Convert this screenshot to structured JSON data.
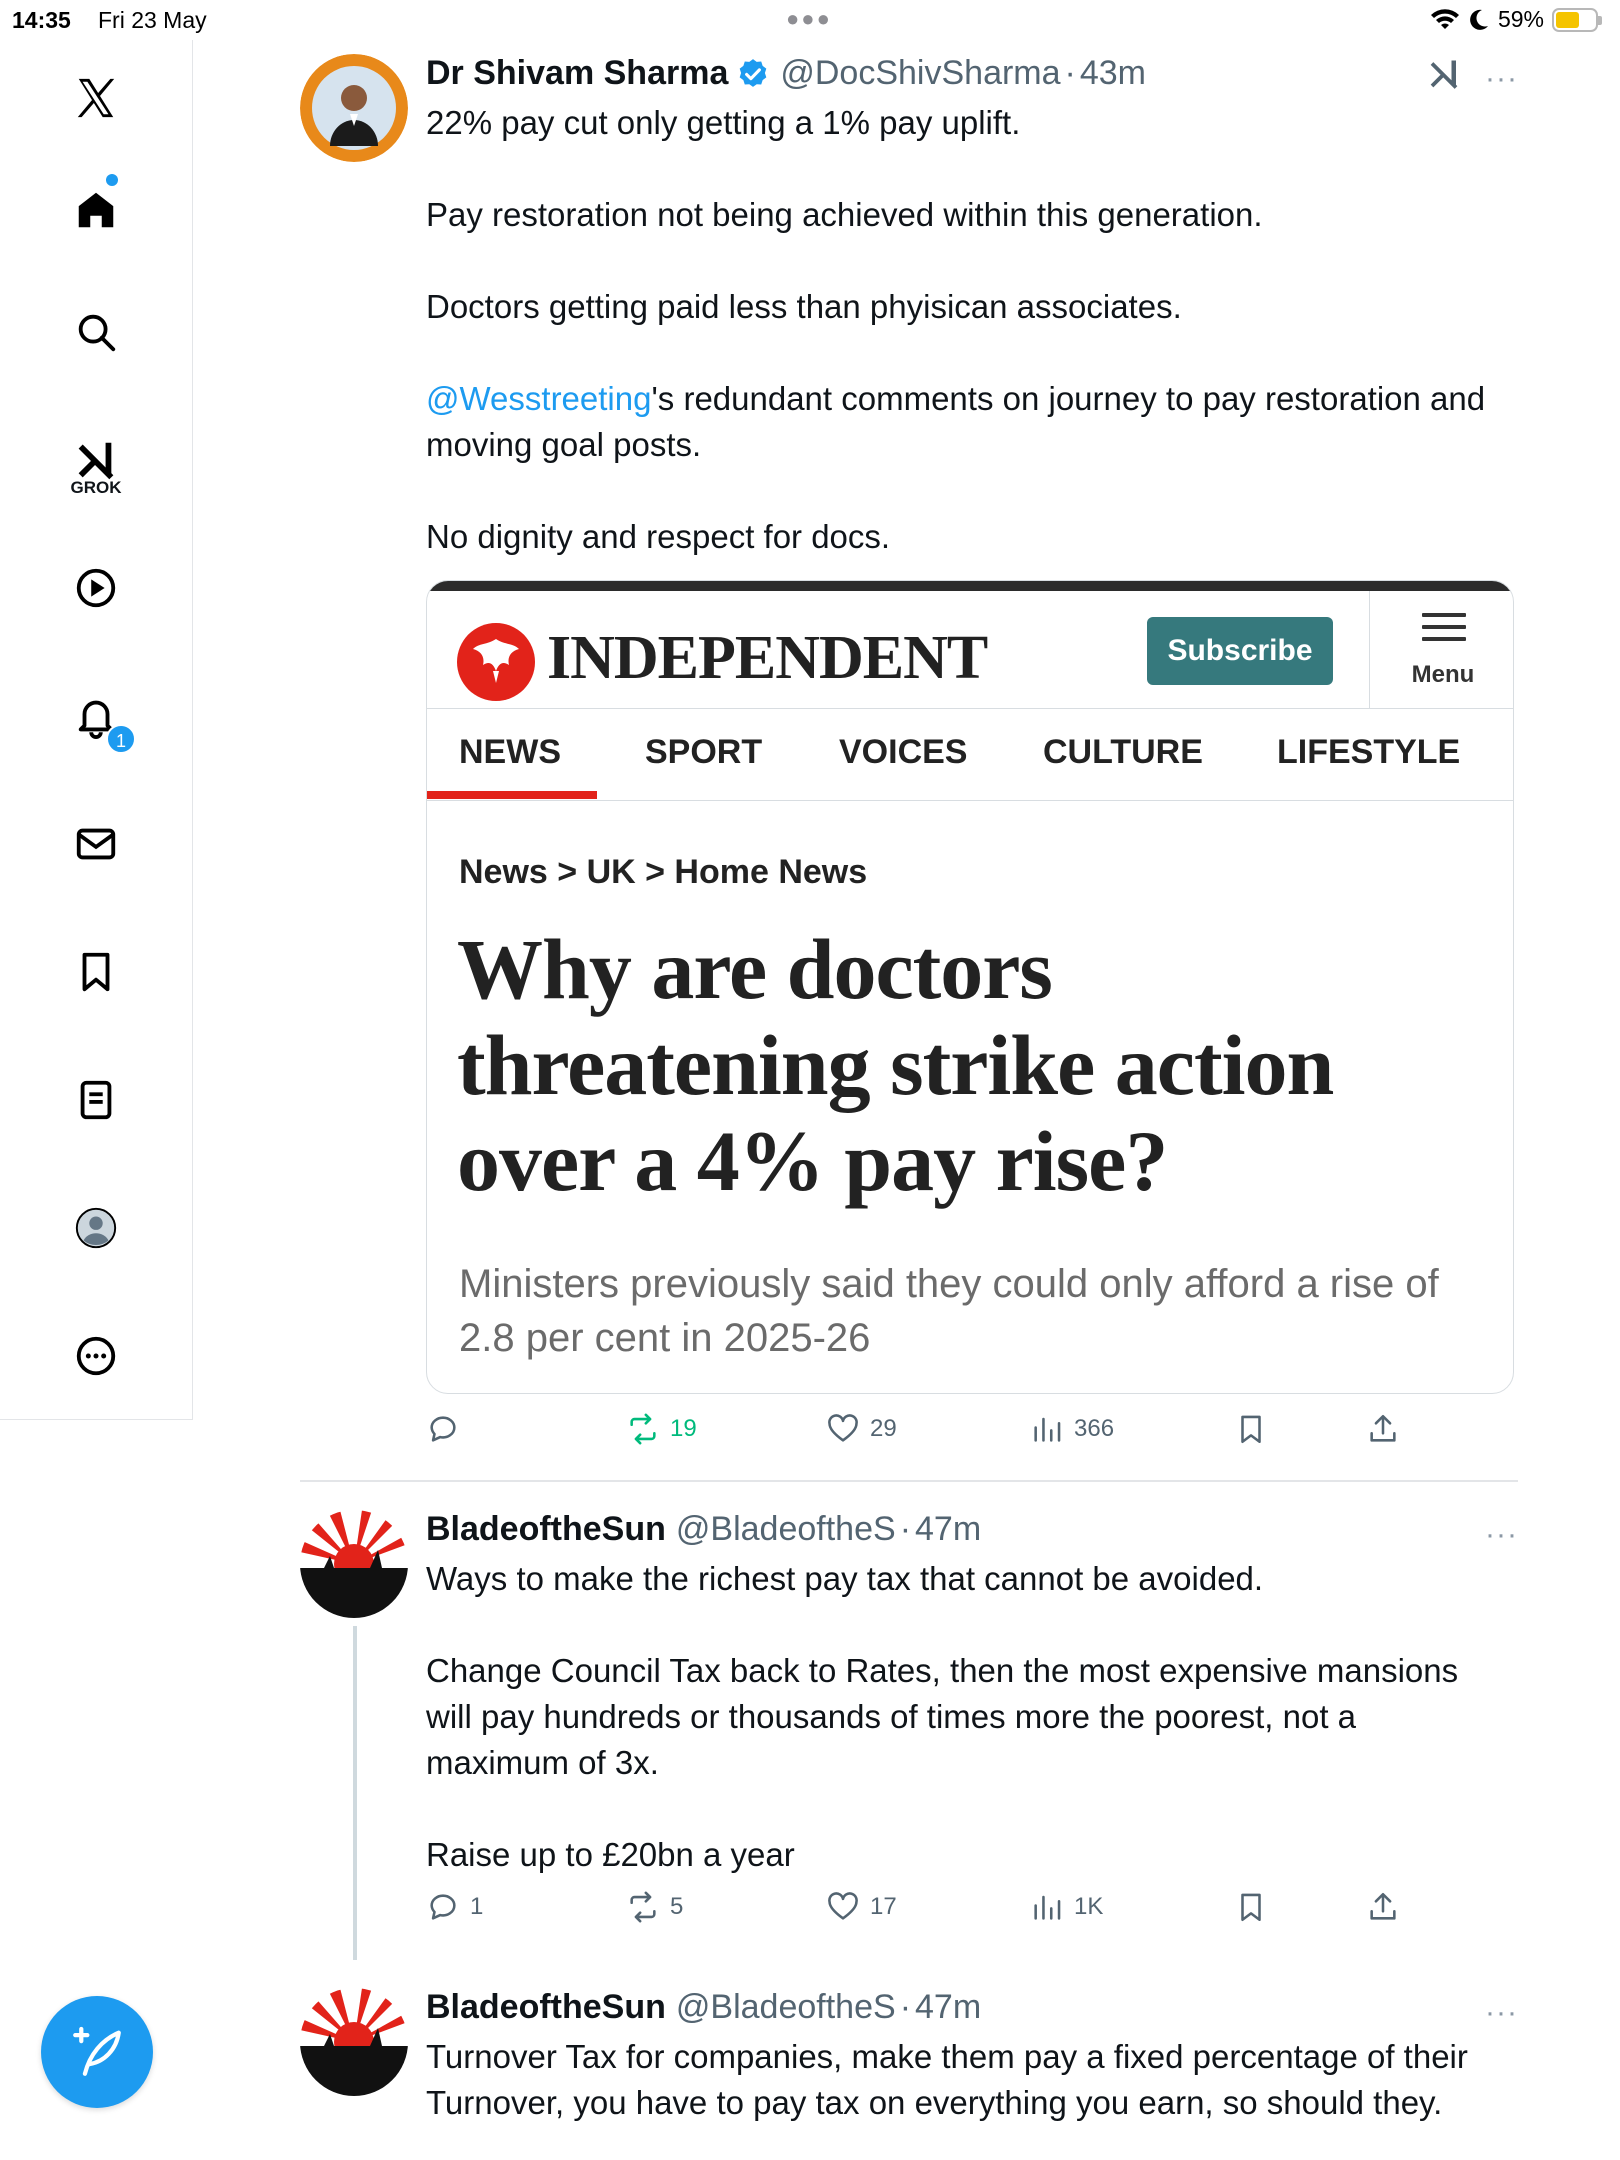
{
  "status_bar": {
    "time": "14:35",
    "date": "Fri 23 May",
    "battery": "59%",
    "battery_level": 0.59
  },
  "sidebar": {
    "grok_label": "GROK",
    "notifications_badge": "1",
    "items": [
      "x-logo-icon",
      "home-icon",
      "search-icon",
      "grok-icon",
      "video-icon",
      "bell-icon",
      "mail-icon",
      "bookmark-icon",
      "lists-icon",
      "profile-icon",
      "more-icon"
    ]
  },
  "tweets": [
    {
      "name": "Dr Shivam Sharma",
      "handle": "@DocShivSharma",
      "sep": "·",
      "time": "43m",
      "more": "···",
      "body": [
        "22% pay cut only getting a 1% pay uplift.",
        "Pay restoration not being achieved within this generation.",
        "Doctors getting paid less than phyisican associates."
      ],
      "mention": "@Wesstreeting",
      "mention_rest": "'s redundant comments on journey to pay restoration and moving goal posts.",
      "last_line": "No dignity and respect for docs.",
      "card": {
        "publication": "INDEPENDENT",
        "subscribe": "Subscribe",
        "menu": "Menu",
        "nav": [
          "NEWS",
          "SPORT",
          "VOICES",
          "CULTURE",
          "LIFESTYLE"
        ],
        "breadcrumb": "News > UK > Home News",
        "headline": "Why are doctors threatening strike action over a 4% pay rise?",
        "standfirst": "Ministers previously said they could only afford a rise of 2.8 per cent in 2025-26"
      },
      "stats": {
        "replies": "",
        "reposts": "19",
        "likes": "29",
        "views": "366"
      }
    },
    {
      "name": "BladeoftheSun",
      "handle": "@BladeoftheS",
      "sep": "·",
      "time": "47m",
      "more": "···",
      "body": [
        "Ways to make the richest pay tax that cannot be avoided.",
        "Change Council Tax back to Rates, then the most expensive mansions will pay hundreds or thousands of times more the poorest, not a maximum of 3x.",
        "Raise up to £20bn a year"
      ],
      "stats": {
        "replies": "1",
        "reposts": "5",
        "likes": "17",
        "views": "1K"
      }
    },
    {
      "name": "BladeoftheSun",
      "handle": "@BladeoftheS",
      "sep": "·",
      "time": "47m",
      "more": "···",
      "body": [
        "Turnover Tax for companies, make them pay a fixed percentage of their Turnover, you have to pay tax on everything you earn, so should they."
      ]
    }
  ],
  "colors": {
    "accent": "#1d9bf0",
    "repost_active": "#00ba7c",
    "independent_red": "#e2231a",
    "subscribe_teal": "#36797d"
  }
}
